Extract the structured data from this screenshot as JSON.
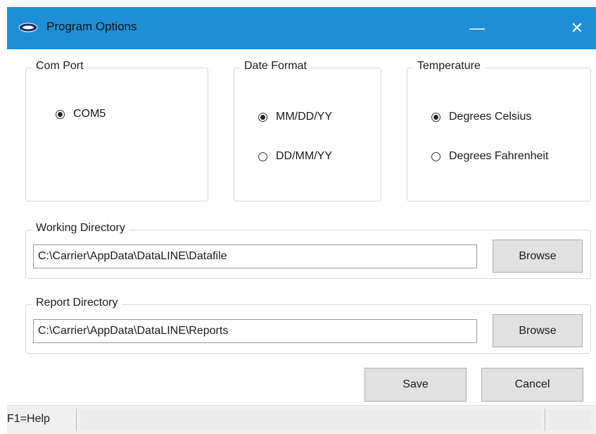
{
  "window": {
    "title": "Program Options",
    "minimize_glyph": "—",
    "close_glyph": "✕",
    "icon": "carrier-logo-icon"
  },
  "com_port": {
    "legend": "Com Port",
    "options": [
      {
        "label": "COM5",
        "checked": true
      }
    ]
  },
  "date_format": {
    "legend": "Date Format",
    "options": [
      {
        "label": "MM/DD/YY",
        "checked": true
      },
      {
        "label": "DD/MM/YY",
        "checked": false
      }
    ]
  },
  "temperature": {
    "legend": "Temperature",
    "options": [
      {
        "label": "Degrees Celsius",
        "checked": true
      },
      {
        "label": "Degrees Fahrenheit",
        "checked": false
      }
    ]
  },
  "working_directory": {
    "legend": "Working Directory",
    "value": "C:\\Carrier\\AppData\\DataLINE\\Datafile",
    "browse_label": "Browse"
  },
  "report_directory": {
    "legend": "Report Directory",
    "value": "C:\\Carrier\\AppData\\DataLINE\\Reports",
    "browse_label": "Browse"
  },
  "actions": {
    "save_label": "Save",
    "cancel_label": "Cancel"
  },
  "statusbar": {
    "help_text": "F1=Help"
  },
  "colors": {
    "titlebar": "#1e8fd6",
    "button_face": "#e1e1e1",
    "group_border": "#d8d8d8"
  }
}
